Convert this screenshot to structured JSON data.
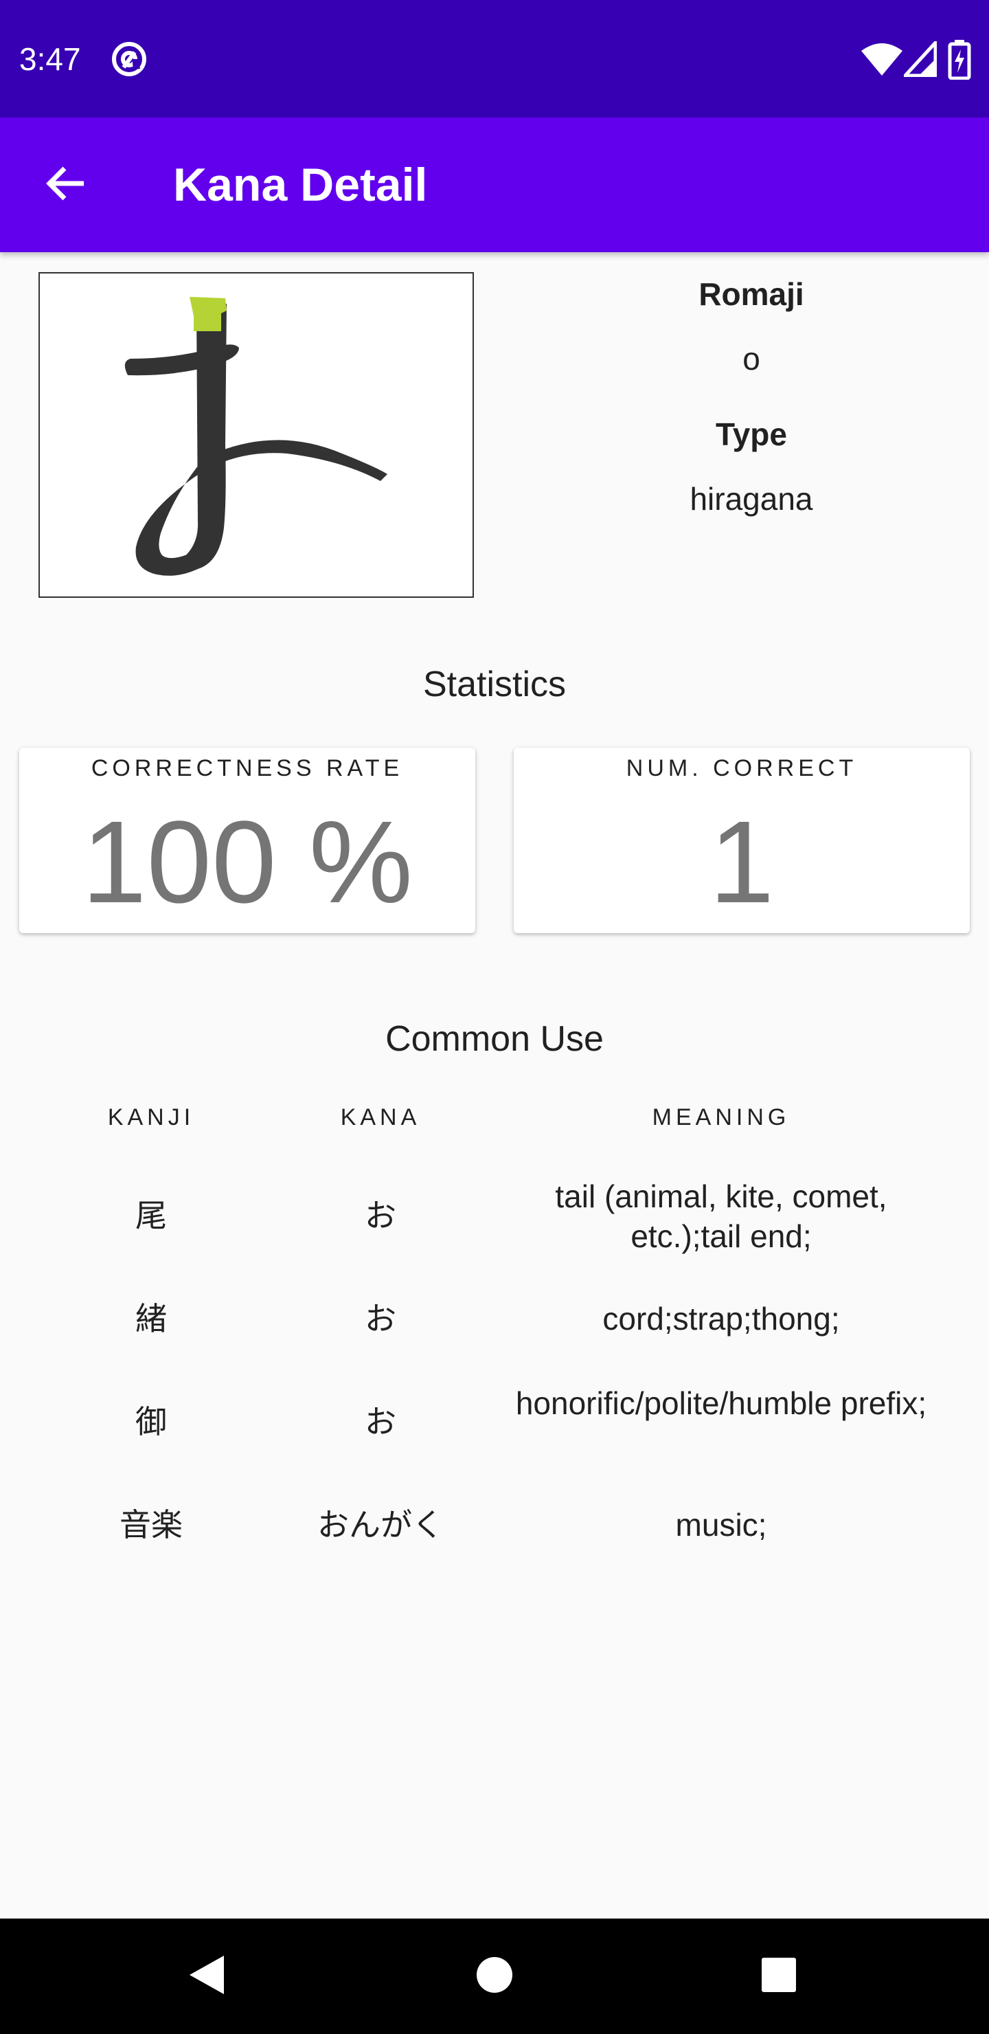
{
  "status_bar": {
    "time": "3:47",
    "icons": [
      "at-sign-icon",
      "wifi-icon",
      "signal-icon",
      "battery-charging-icon"
    ]
  },
  "app_bar": {
    "title": "Kana Detail",
    "back_icon": "arrow-back-icon"
  },
  "kana": {
    "character": "お",
    "romaji_label": "Romaji",
    "romaji_value": "o",
    "type_label": "Type",
    "type_value": "hiragana"
  },
  "statistics": {
    "title": "Statistics",
    "correctness_label": "CORRECTNESS RATE",
    "correctness_value": "100 %",
    "num_correct_label": "NUM. CORRECT",
    "num_correct_value": "1"
  },
  "common_use": {
    "title": "Common Use",
    "headers": {
      "kanji": "KANJI",
      "kana": "KANA",
      "meaning": "MEANING"
    },
    "rows": [
      {
        "kanji": "尾",
        "kana": "お",
        "meaning": "tail (animal, kite, comet, etc.);tail end;"
      },
      {
        "kanji": "緒",
        "kana": "お",
        "meaning": "cord;strap;thong;"
      },
      {
        "kanji": "御",
        "kana": "お",
        "meaning": "honorific/polite/humble prefix;"
      },
      {
        "kanji": "音楽",
        "kana": "おんがく",
        "meaning": "music;"
      }
    ]
  },
  "nav_bar": {
    "icons": [
      "back-triangle-icon",
      "home-circle-icon",
      "recents-square-icon"
    ]
  },
  "colors": {
    "status_bar": "#3700b3",
    "app_bar": "#6200ee",
    "stroke_highlight": "#b5d334",
    "stroke": "#333333"
  }
}
